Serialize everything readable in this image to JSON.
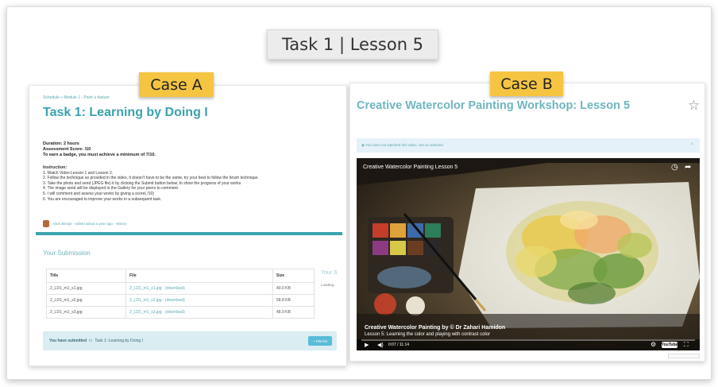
{
  "header": {
    "title": "Task 1 | Lesson 5"
  },
  "cases": {
    "a": "Case A",
    "b": "Case B"
  },
  "panel_a": {
    "breadcrumb": "Schedule » Module 1 - Paint a feature",
    "title": "Task 1: Learning by Doing I",
    "duration": "Duration: 2 hours",
    "score": "Assessment Score: /10",
    "badge": "To earn a badge, you must achieve a minimum of 7/10.",
    "instruction_heading": "Instruction:",
    "instructions": [
      "1. Watch Video Lesson 1 and Lesson 2.",
      "2. Follow the technique as provided in the video, it doesn't have to be the same, try your best to follow the brush technique.",
      "3. Take the photo and send (JPEG file) it by clicking the Submit button below, to show the progress of your works",
      "4. The image send will be displayed in the Gallery for your peers to comment.",
      "5. I will comment and assess your works by giving a score(   /10)",
      "6. You are encouraged to improve your works in a subsequent task."
    ],
    "author": "Alam Berajri · edited about a year ago · History",
    "submission_title": "Your Submission",
    "side_title": "Your S",
    "side_status": "Loading...",
    "table": {
      "headers": [
        "Title",
        "File",
        "Size"
      ],
      "rows": [
        [
          "2_LD1_m1_s1.jpg",
          "2_LD1_m1_s1.jpg · (download)",
          "40.0 KB"
        ],
        [
          "2_LD1_m1_s2.jpg",
          "2_LD1_m1_s2.jpg · (download)",
          "58.8 KB"
        ],
        [
          "2_LD1_m1_s3.jpg",
          "2_LD1_m1_s3.jpg · (download)",
          "48.9 KB"
        ]
      ]
    },
    "notice": {
      "prefix": "You have submitted",
      "joiner": "to",
      "link": "Task 1: Learning by Doing I",
      "button": "+ File list"
    }
  },
  "panel_b": {
    "title": "Creative Watercolor Painting Workshop: Lesson 5",
    "star_icon": "star-outline-icon",
    "watched_text": "◉ You have not watched this video. Set as watched",
    "video": {
      "title": "Creative Watercolor Painting Lesson 5",
      "overlay_line1": "Creative Watercolor Painting by © Dr Zahari Hamidon",
      "overlay_line2": "Lesson 5: Learning the color and playing with contrast color",
      "time": "0:07 / 11:14",
      "logo": "YouTube"
    }
  },
  "colors": {
    "accent": "#3aa3ae",
    "label_yellow": "#f5c542",
    "notice_bg": "#d9edf2"
  }
}
